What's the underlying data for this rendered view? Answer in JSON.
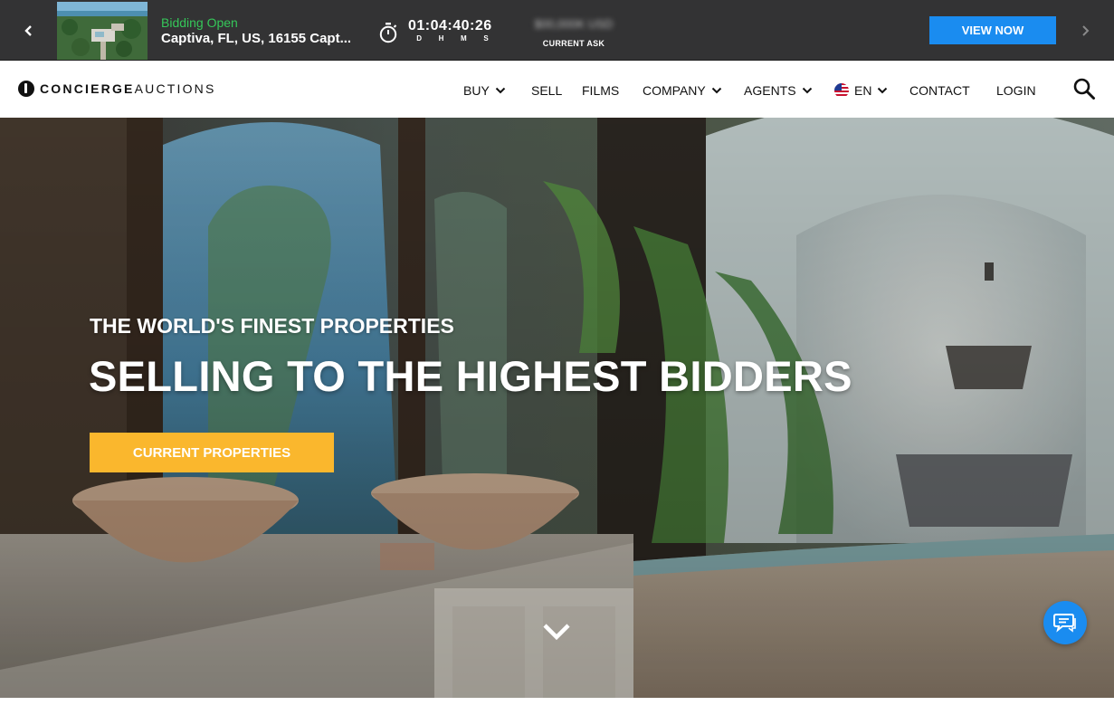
{
  "ticker": {
    "prev_icon": "chevron-left-icon",
    "next_icon": "chevron-right-icon",
    "status": "Bidding Open",
    "address": "Captiva, FL, US, 16155 Capt...",
    "timer_icon": "stopwatch-icon",
    "countdown": "01:04:40:26",
    "units": [
      "D",
      "H",
      "M",
      "S"
    ],
    "current_ask_value": "$00,000K USD",
    "current_ask_label": "CURRENT ASK",
    "view_now_label": "VIEW NOW",
    "status_color": "#35c759",
    "button_color": "#1a8cf0"
  },
  "nav": {
    "logo_bold": "CONCIERGE",
    "logo_light": "AUCTIONS",
    "items": {
      "buy": "BUY",
      "sell": "SELL",
      "films": "FILMS",
      "company": "COMPANY",
      "agents": "AGENTS",
      "language": "EN",
      "contact": "CONTACT",
      "login": "LOGIN"
    },
    "search_icon": "search-icon",
    "language_flag": "us-flag-icon"
  },
  "hero": {
    "kicker": "THE WORLD'S FINEST PROPERTIES",
    "headline": "SELLING TO THE HIGHEST BIDDERS",
    "cta_label": "CURRENT PROPERTIES",
    "cta_color": "#fab72d",
    "scroll_icon": "chevron-down-icon",
    "chat_icon": "chat-bubble-icon"
  }
}
